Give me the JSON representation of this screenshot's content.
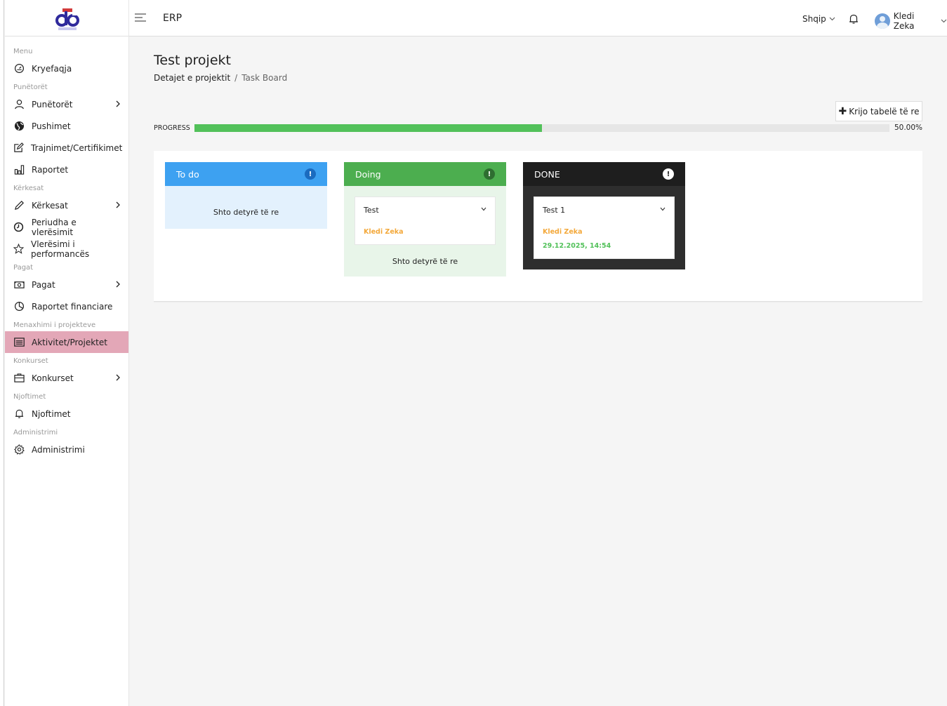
{
  "app": {
    "title": "ERP"
  },
  "header": {
    "language": "Shqip",
    "user_name": "Kledi Zeka"
  },
  "sidebar": {
    "sections": {
      "menu": "Menu",
      "punetoret": "Punëtorët",
      "kerkesat": "Kërkesat",
      "pagat": "Pagat",
      "projektet": "Menaxhimi i projekteve",
      "konkurset": "Konkurset",
      "njoftimet": "Njoftimet",
      "administrimi": "Administrimi"
    },
    "items": {
      "kryefaqja": "Kryefaqja",
      "punetoret": "Punëtorët",
      "pushimet": "Pushimet",
      "trajnimet": "Trajnimet/Certifikimet",
      "raportet": "Raportet",
      "kerkesat": "Kërkesat",
      "periudha": "Periudha e vlerësimit",
      "vleresimi": "Vlerësimi i performancës",
      "pagat": "Pagat",
      "raportet_financiare": "Raportet financiare",
      "aktivitetet": "Aktivitet/Projektet",
      "konkurset": "Konkurset",
      "njoftimet": "Njoftimet",
      "administrimi": "Administrimi"
    }
  },
  "page": {
    "title": "Test projekt",
    "breadcrumb": {
      "parent": "Detajet e projektit",
      "separator": "/",
      "current": "Task Board"
    },
    "create_button": "Krijo tabelë të re",
    "progress": {
      "label": "PROGRESS",
      "value": 0.5,
      "text": "50.00%"
    }
  },
  "board": {
    "columns": [
      {
        "title": "To do",
        "color": "#3da1f1",
        "body_color": "#e3f1fd",
        "icon_color": "#1b6bbf",
        "add_label": "Shto detyrë të re",
        "cards": []
      },
      {
        "title": "Doing",
        "color": "#4cae4f",
        "body_color": "#e8f5e9",
        "icon_color": "#2e6e31",
        "add_label": "Shto detyrë të re",
        "cards": [
          {
            "title": "Test",
            "assignee": "Kledi Zeka"
          }
        ]
      },
      {
        "title": "DONE",
        "color": "#1e1e1e",
        "body_color": "#2e2e2e",
        "icon_color": "#ffffff",
        "cards": [
          {
            "title": "Test 1",
            "assignee": "Kledi Zeka",
            "date": "29.12.2025, 14:54"
          }
        ]
      }
    ]
  }
}
